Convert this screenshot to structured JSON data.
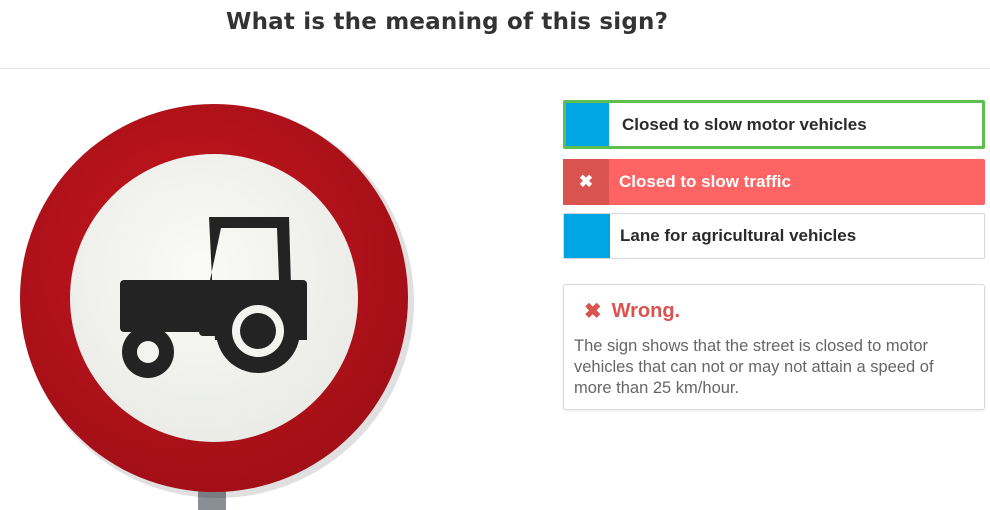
{
  "question": {
    "title": "What is the meaning of this sign?"
  },
  "sign": {
    "icon": "tractor-icon",
    "description_colors": {
      "ring": "#b5121b",
      "face": "#f3f4f0",
      "symbol": "#222222",
      "pole": "#8a8f95"
    }
  },
  "answers": [
    {
      "label": "Closed to slow motor vehicles",
      "state": "correct"
    },
    {
      "label": "Closed to slow traffic",
      "state": "wrong-selected",
      "icon": "close-icon",
      "icon_glyph": "✖"
    },
    {
      "label": "Lane for agricultural vehicles",
      "state": "neutral"
    }
  ],
  "feedback": {
    "icon": "close-icon",
    "icon_glyph": "✖",
    "heading": "Wrong.",
    "text": "The sign shows that the street is closed to motor vehicles that can not or may not attain a speed of more than 25 km/hour."
  },
  "colors": {
    "accent_blue": "#00a6e4",
    "correct_green": "#5cbf4f",
    "wrong_red": "#ff6464",
    "wrong_dark_red": "#d9534f"
  }
}
